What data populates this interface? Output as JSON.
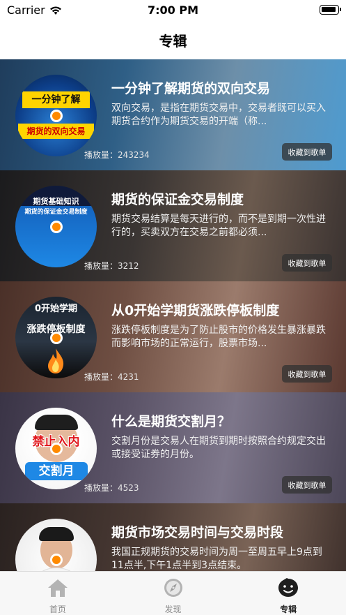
{
  "status": {
    "carrier": "Carrier",
    "time": "7:00 PM"
  },
  "nav": {
    "title": "专辑"
  },
  "cards": [
    {
      "title": "一分钟了解期货的双向交易",
      "desc": "双向交易，是指在期货交易中，交易者既可以买入期货合约作为期货交易的开端（称...",
      "plays": "播放量：243234",
      "button": "收藏到歌单",
      "cover_top": "一分钟了解",
      "cover_bottom": "期货的双向交易"
    },
    {
      "title": "期货的保证金交易制度",
      "desc": "期货交易结算是每天进行的，而不是到期一次性进行的，买卖双方在交易之前都必须...",
      "plays": "播放量：3212",
      "button": "收藏到歌单",
      "cover_top": "期货基础知识",
      "cover_bottom": "期货的保证金交易制度"
    },
    {
      "title": "从0开始学期货涨跌停板制度",
      "desc": "涨跌停板制度是为了防止股市的价格发生暴涨暴跌而影响市场的正常运行，股票市场...",
      "plays": "播放量：4231",
      "button": "收藏到歌单",
      "cover_top": "0开始学期",
      "cover_bottom": "涨跌停板制度"
    },
    {
      "title": "什么是期货交割月？",
      "desc": "交割月份是交易人在期货到期时按照合约规定交出或接受证券的月份。",
      "plays": "播放量：4523",
      "button": "收藏到歌单",
      "cover_top": "禁止入内",
      "cover_bottom": "交割月"
    },
    {
      "title": "期货市场交易时间与交易时段",
      "desc": "我国正规期货的交易时间为周一至周五早上9点到11点半,下午1点半到3点结束。",
      "plays": "",
      "button": "",
      "cover_top": "",
      "cover_bottom": ""
    }
  ],
  "tabs": [
    {
      "label": "首页",
      "icon": "home-icon"
    },
    {
      "label": "发现",
      "icon": "compass-icon"
    },
    {
      "label": "专辑",
      "icon": "album-icon"
    }
  ],
  "colors": {
    "accent": "#ff8a00",
    "tab_active": "#222222",
    "tab_inactive": "#888888"
  }
}
